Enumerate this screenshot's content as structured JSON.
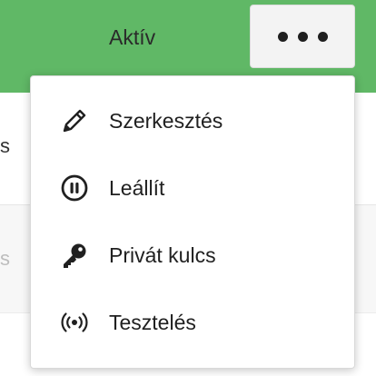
{
  "header": {
    "status_label": "Aktív",
    "more_button": {
      "icon": "more-dots-icon"
    }
  },
  "background": {
    "row1_fragment": "s",
    "row2_fragment": "s"
  },
  "menu": {
    "items": [
      {
        "label": "Szerkesztés",
        "icon": "pencil-icon"
      },
      {
        "label": "Leállít",
        "icon": "pause-circle-icon"
      },
      {
        "label": "Privát kulcs",
        "icon": "key-icon"
      },
      {
        "label": "Tesztelés",
        "icon": "broadcast-icon"
      }
    ]
  },
  "colors": {
    "header_green": "#60b866",
    "button_bg": "#f3f3f3",
    "text": "#202020"
  }
}
